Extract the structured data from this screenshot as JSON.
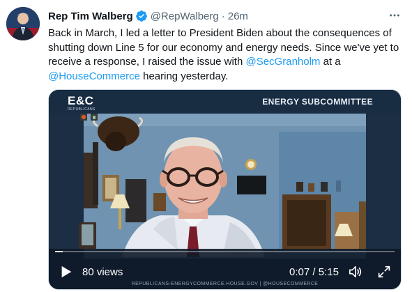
{
  "author": {
    "name": "Rep Tim Walberg",
    "handle": "@RepWalberg",
    "separator": "·",
    "time": "26m"
  },
  "tweet": {
    "part1": "Back in March, I led a letter to President Biden about the consequences of shutting down Line 5 for our economy and energy needs. Since we've yet to receive a response, I raised the issue with ",
    "mention1": "@SecGranholm",
    "part2": " at a ",
    "mention2": "@HouseCommerce",
    "part3": " hearing yesterday."
  },
  "video": {
    "logo": "E&C",
    "logo_sub": "REPUBLICANS",
    "banner": "ENERGY SUBCOMMITTEE",
    "footer": "REPUBLICANS-ENERGYCOMMERCE.HOUSE.GOV | @HOUSECOMMERCE",
    "views": "80 views",
    "elapsed": "0:07",
    "divider": "/",
    "duration": "5:15",
    "progress": 0.022
  },
  "colors": {
    "link": "#1d9bf0",
    "verified": "#1d9bf0",
    "handle": "#536471"
  },
  "icons": [
    "verified-icon",
    "more-icon",
    "play-icon",
    "volume-icon",
    "fullscreen-icon"
  ]
}
